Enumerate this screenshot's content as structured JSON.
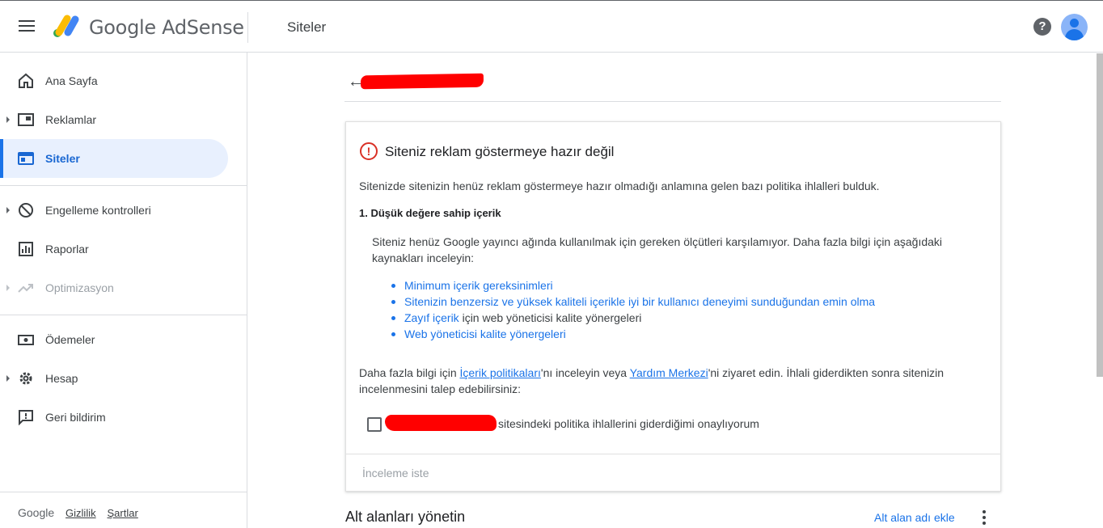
{
  "header": {
    "brand": "Google AdSense",
    "page_title": "Siteler",
    "help_glyph": "?"
  },
  "sidebar": {
    "items": [
      {
        "label": "Ana Sayfa",
        "icon": "home-icon"
      },
      {
        "label": "Reklamlar",
        "icon": "ads-icon"
      },
      {
        "label": "Siteler",
        "icon": "sites-icon"
      },
      {
        "label": "Engelleme kontrolleri",
        "icon": "block-icon"
      },
      {
        "label": "Raporlar",
        "icon": "reports-icon"
      },
      {
        "label": "Optimizasyon",
        "icon": "trending-icon"
      },
      {
        "label": "Ödemeler",
        "icon": "payments-icon"
      },
      {
        "label": "Hesap",
        "icon": "gear-icon"
      },
      {
        "label": "Geri bildirim",
        "icon": "feedback-icon"
      }
    ],
    "footer": {
      "google": "Google",
      "privacy": "Gizlilik",
      "terms": "Şartlar"
    }
  },
  "main": {
    "card": {
      "title": "Siteniz reklam göstermeye hazır değil",
      "intro": "Sitenizde sitenizin henüz reklam göstermeye hazır olmadığı anlamına gelen bazı politika ihlalleri bulduk.",
      "section_heading": "1. Düşük değere sahip içerik",
      "section_desc": "Siteniz henüz Google yayıncı ağında kullanılmak için gereken ölçütleri karşılamıyor. Daha fazla bilgi için aşağıdaki kaynakları inceleyin:",
      "links": {
        "l1": "Minimum içerik gereksinimleri",
        "l2": "Sitenizin benzersiz ve yüksek kaliteli içerikle iyi bir kullanıcı deneyimi sunduğundan emin olma",
        "l3_link": "Zayıf içerik",
        "l3_rest": " için web yöneticisi kalite yönergeleri",
        "l4": "Web yöneticisi kalite yönergeleri"
      },
      "more_info": {
        "p1": "Daha fazla bilgi için ",
        "link1": "İçerik politikaları",
        "p2": "'nı inceleyin veya ",
        "link2": "Yardım Merkezi",
        "p3": "'ni ziyaret edin. İhlali giderdikten sonra sitenizin incelenmesini talep edebilirsiniz:"
      },
      "confirm_text": "sitesindeki politika ihlallerini giderdiğimi onaylıyorum",
      "review_button": "İnceleme iste"
    },
    "subdomains": {
      "title": "Alt alanları yönetin",
      "add_label": "Alt alan adı ekle"
    }
  }
}
